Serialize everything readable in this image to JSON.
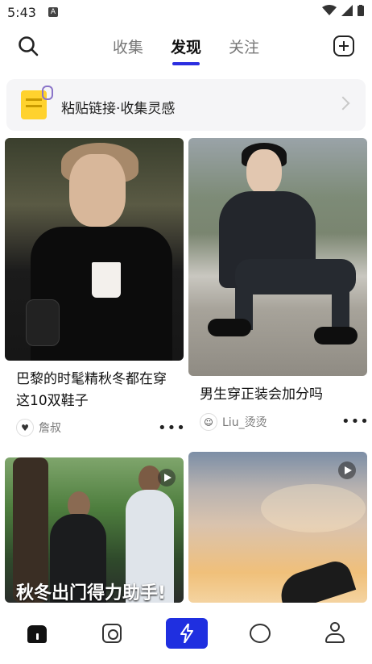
{
  "status": {
    "time": "5:43",
    "notification_badge": "A"
  },
  "header": {
    "tabs": [
      {
        "label": "收集",
        "active": false
      },
      {
        "label": "发现",
        "active": true
      },
      {
        "label": "关注",
        "active": false
      }
    ]
  },
  "paste_banner": {
    "text": "粘贴链接·收集灵感"
  },
  "feed": {
    "cards": [
      {
        "title": "巴黎的时髦精秋冬都在穿这10双鞋子",
        "author": "詹叔"
      },
      {
        "title": "男生穿正装会加分吗",
        "author": "Liu_烫烫"
      },
      {
        "overlay_text": "秋冬出门得力助手!",
        "has_video": true
      },
      {
        "has_video": true
      }
    ],
    "more_label": "•••"
  },
  "bottom_nav": {
    "items": [
      "home-icon",
      "scan-icon",
      "bolt-icon",
      "chat-icon",
      "profile-icon"
    ],
    "accent": "#1f2fe0"
  },
  "colors": {
    "accent": "#2b2ee0",
    "note": "#ffd22e"
  }
}
